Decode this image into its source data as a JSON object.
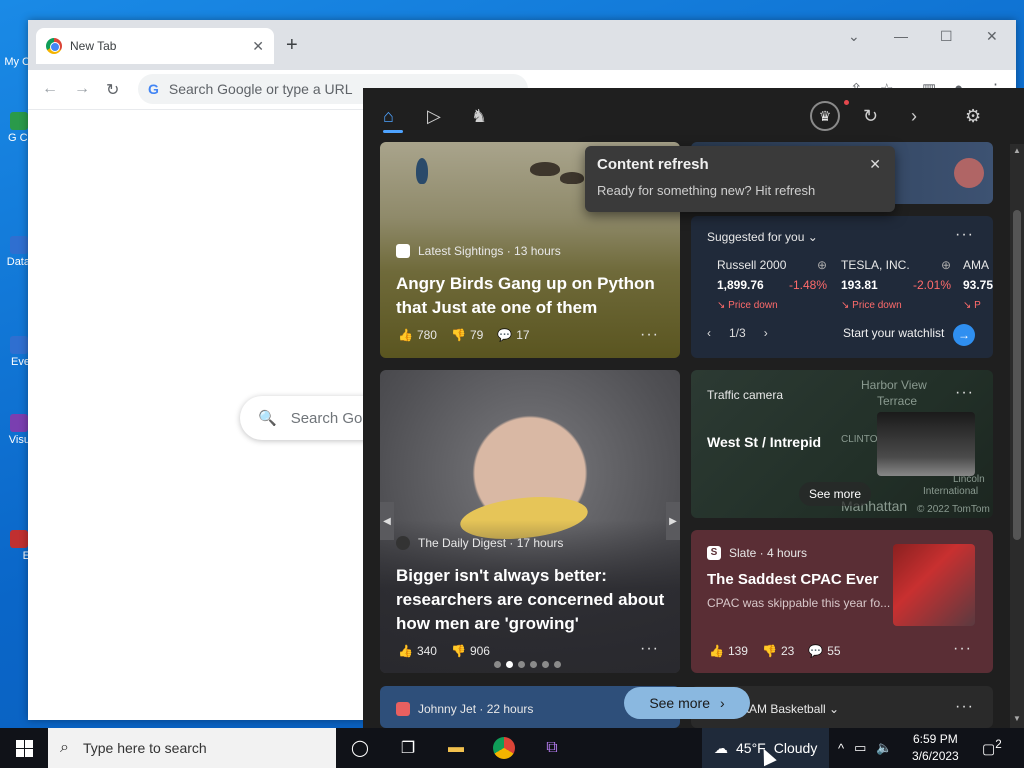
{
  "browser": {
    "tab_title": "New Tab",
    "omnibox_placeholder": "Search Google or type a URL",
    "ntp_search_placeholder": "Search Go"
  },
  "desktop": {
    "icon_labels": [
      "My C",
      "G Cl",
      "Data",
      "Eve",
      "Visu",
      "E"
    ]
  },
  "tooltip": {
    "title": "Content refresh",
    "body": "Ready for something new? Hit refresh"
  },
  "cards": {
    "birds": {
      "source": "Latest Sightings · 13 hours",
      "headline": "Angry Birds Gang up on Python that Just ate one of them",
      "likes": "780",
      "dislikes": "79",
      "comments": "17"
    },
    "watchlist": {
      "label": "Suggested for you",
      "stocks": [
        {
          "name": "Russell 2000",
          "price": "1,899.76",
          "change": "-1.48%",
          "status": "Price down"
        },
        {
          "name": "TESLA, INC.",
          "price": "193.81",
          "change": "-2.01%",
          "status": "Price down"
        },
        {
          "name": "AMA",
          "price": "93.75",
          "change": "",
          "status": "P"
        }
      ],
      "pager": "1/3",
      "cta": "Start your watchlist"
    },
    "digest": {
      "source": "The Daily Digest · 17 hours",
      "headline": "Bigger isn't always better: researchers are concerned about how men are 'growing'",
      "likes": "340",
      "dislikes": "906"
    },
    "traffic": {
      "label": "Traffic camera",
      "location": "West St / Intrepid",
      "see_more": "See more",
      "map_labels": [
        "Harbor View",
        "Terrace",
        "CLINTON",
        "Lincoln",
        "International",
        "Manhattan",
        "© 2022 TomTom"
      ]
    },
    "slate": {
      "source": "Slate · 4 hours",
      "headline": "The Saddest CPAC Ever",
      "summary": "CPAC was skippable this year fo...",
      "likes": "139",
      "dislikes": "23",
      "comments": "55"
    },
    "bottom_left": {
      "source": "Johnny Jet · 22 hours"
    },
    "bottom_right": {
      "label": "AAM Basketball"
    }
  },
  "panel": {
    "see_more": "See more"
  },
  "taskbar": {
    "search_placeholder": "Type here to search",
    "weather_temp": "45°F",
    "weather_desc": "Cloudy",
    "time": "6:59 PM",
    "date": "3/6/2023",
    "notif_count": "2"
  },
  "colors": {
    "accent": "#4ea3ff",
    "price_down": "#ff6b6b",
    "panel_bg": "#1f1f1f"
  }
}
